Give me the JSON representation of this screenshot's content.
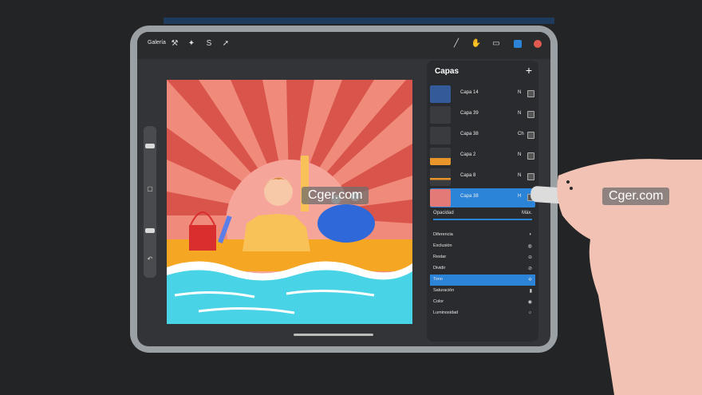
{
  "toolbar": {
    "gallery_label": "Galería",
    "icons": [
      "wrench-icon",
      "magic-wand-icon",
      "selection-s-icon",
      "arrow-icon",
      "brush-icon",
      "smudge-icon",
      "eraser-icon",
      "layers-icon",
      "color-icon"
    ]
  },
  "layers_panel": {
    "title": "Capas",
    "add_symbol": "+",
    "layers": [
      {
        "name": "Capa 14",
        "mode": "N",
        "checked": true,
        "selected": false
      },
      {
        "name": "Capa 39",
        "mode": "N",
        "checked": true,
        "selected": false
      },
      {
        "name": "Capa 38",
        "mode": "Ch",
        "checked": true,
        "selected": false
      },
      {
        "name": "Capa 2",
        "mode": "N",
        "checked": true,
        "selected": false
      },
      {
        "name": "Capa 8",
        "mode": "N",
        "checked": true,
        "selected": false
      },
      {
        "name": "Capa 38",
        "mode": "H",
        "checked": true,
        "selected": true
      }
    ],
    "opacity_label": "Opacidad",
    "opacity_max_label": "Máx.",
    "opacity_value": 1.0,
    "blend_modes": [
      {
        "name": "Diferencia",
        "icon": "◐",
        "selected": false
      },
      {
        "name": "Exclusión",
        "icon": "◍",
        "selected": false
      },
      {
        "name": "Restar",
        "icon": "⊖",
        "selected": false
      },
      {
        "name": "Dividir",
        "icon": "⊘",
        "selected": false
      },
      {
        "name": "Tono",
        "icon": "✲",
        "selected": true
      },
      {
        "name": "Saturación",
        "icon": "▮",
        "selected": false
      },
      {
        "name": "Color",
        "icon": "◉",
        "selected": false
      },
      {
        "name": "Luminosidad",
        "icon": "☼",
        "selected": false
      }
    ]
  },
  "watermarks": [
    "Cger.com",
    "Cger.com"
  ],
  "colors": {
    "accent": "#2b84d8",
    "sky_light": "#f08a7a",
    "sky_dark": "#d9554c",
    "sun": "#f6a59a",
    "sand": "#f5a623",
    "sea": "#49d3e6",
    "pencil_tip": "#ffffff"
  }
}
